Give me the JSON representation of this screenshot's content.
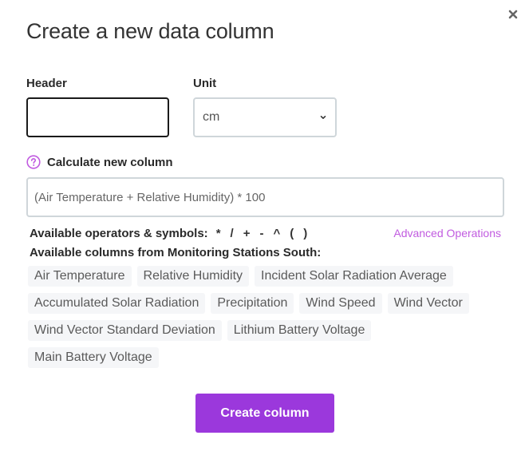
{
  "dialog": {
    "title": "Create a new data column",
    "close_icon": "close-icon"
  },
  "header_field": {
    "label": "Header",
    "value": "",
    "placeholder": ""
  },
  "unit_field": {
    "label": "Unit",
    "selected": "cm"
  },
  "calculate": {
    "label": "Calculate new column",
    "help_icon": "question-circle-icon",
    "formula_placeholder": "(Air Temperature + Relative Humidity) * 100",
    "formula_value": ""
  },
  "operators": {
    "label": "Available operators & symbols:",
    "symbols": [
      "*",
      "/",
      "+",
      "-",
      "^",
      "(",
      ")"
    ],
    "advanced_link": "Advanced Operations"
  },
  "columns": {
    "label": "Available columns from Monitoring Stations South:",
    "items": [
      "Air Temperature",
      "Relative Humidity",
      "Incident Solar Radiation Average",
      "Accumulated Solar Radiation",
      "Precipitation",
      "Wind Speed",
      "Wind Vector",
      "Wind Vector Standard Deviation",
      "Lithium Battery Voltage",
      "Main Battery Voltage"
    ]
  },
  "actions": {
    "create_label": "Create column"
  },
  "colors": {
    "accent": "#9b38dc",
    "link": "#c15be0",
    "chip_bg": "#f5f6f8"
  }
}
